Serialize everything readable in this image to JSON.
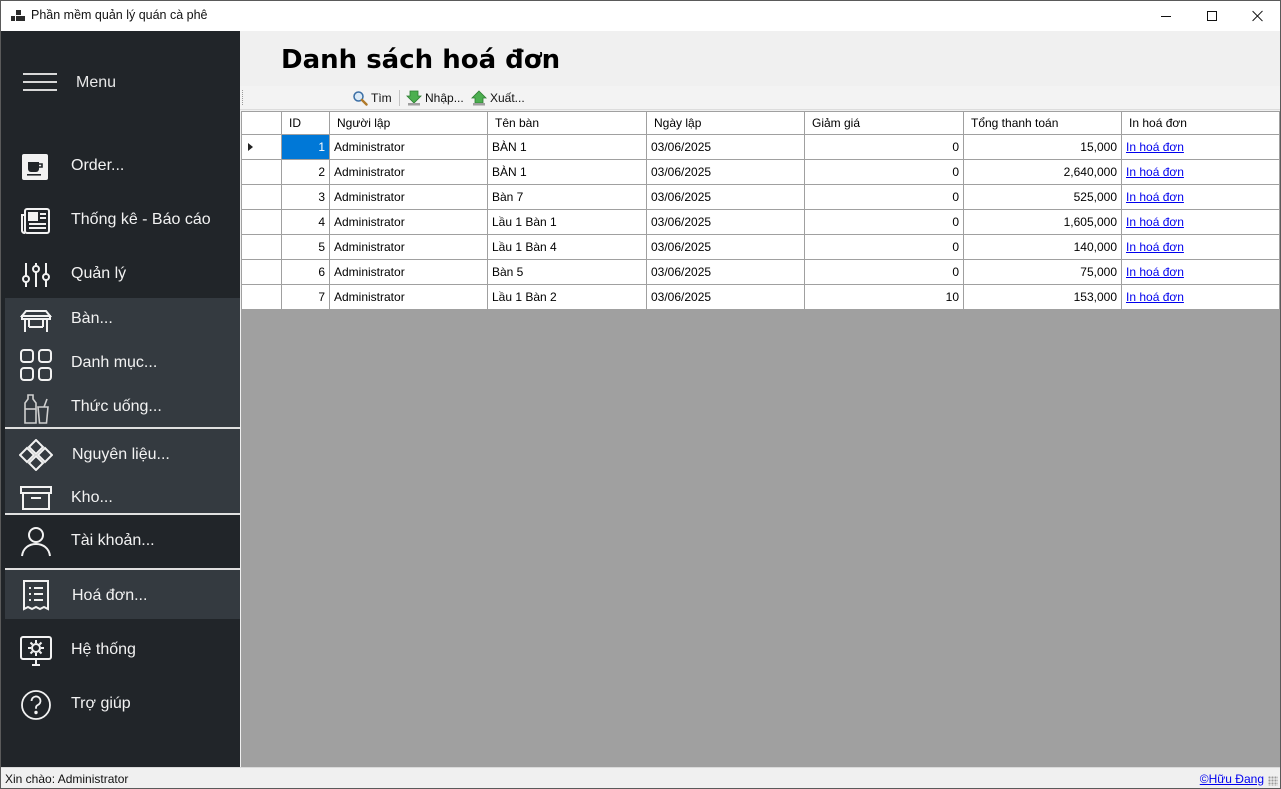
{
  "window": {
    "title": "Phần mềm quản lý quán cà phê"
  },
  "sidebar": {
    "menu_label": "Menu",
    "items": [
      {
        "label": "Order...",
        "icon": "coffee-icon"
      },
      {
        "label": "Thống kê - Báo cáo",
        "icon": "newspaper-icon"
      },
      {
        "label": "Quản lý",
        "icon": "sliders-icon"
      },
      {
        "label": "Bàn...",
        "icon": "table-icon"
      },
      {
        "label": "Danh mục...",
        "icon": "grid-icon"
      },
      {
        "label": "Thức uống...",
        "icon": "drinks-icon"
      },
      {
        "label": "Nguyên liệu...",
        "icon": "ingredients-icon"
      },
      {
        "label": "Kho...",
        "icon": "storage-box-icon"
      },
      {
        "label": "Tài khoản...",
        "icon": "user-icon"
      },
      {
        "label": "Hoá đơn...",
        "icon": "receipt-icon"
      },
      {
        "label": "Hệ thống",
        "icon": "monitor-settings-icon"
      },
      {
        "label": "Trợ giúp",
        "icon": "help-icon"
      }
    ]
  },
  "main": {
    "title": "Danh sách hoá đơn",
    "toolbar": {
      "search_label": "Tìm",
      "import_label": "Nhập...",
      "export_label": "Xuất..."
    },
    "table": {
      "columns": [
        "ID",
        "Người lập",
        "Tên bàn",
        "Ngày lập",
        "Giảm giá",
        "Tổng thanh toán",
        "In hoá đơn"
      ],
      "rows": [
        {
          "id": "1",
          "creator": "Administrator",
          "table": "BÀN 1",
          "date": "03/06/2025",
          "discount": "0",
          "total": "15,000",
          "print": "In hoá đơn"
        },
        {
          "id": "2",
          "creator": "Administrator",
          "table": "BÀN 1",
          "date": "03/06/2025",
          "discount": "0",
          "total": "2,640,000",
          "print": "In hoá đơn"
        },
        {
          "id": "3",
          "creator": "Administrator",
          "table": "Bàn 7",
          "date": "03/06/2025",
          "discount": "0",
          "total": "525,000",
          "print": "In hoá đơn"
        },
        {
          "id": "4",
          "creator": "Administrator",
          "table": "Lầu 1 Bàn 1",
          "date": "03/06/2025",
          "discount": "0",
          "total": "1,605,000",
          "print": "In hoá đơn"
        },
        {
          "id": "5",
          "creator": "Administrator",
          "table": "Lầu 1 Bàn 4",
          "date": "03/06/2025",
          "discount": "0",
          "total": "140,000",
          "print": "In hoá đơn"
        },
        {
          "id": "6",
          "creator": "Administrator",
          "table": "Bàn 5",
          "date": "03/06/2025",
          "discount": "0",
          "total": "75,000",
          "print": "In hoá đơn"
        },
        {
          "id": "7",
          "creator": "Administrator",
          "table": "Lầu 1 Bàn 2",
          "date": "03/06/2025",
          "discount": "10",
          "total": "153,000",
          "print": "In hoá đơn"
        }
      ]
    }
  },
  "status": {
    "greeting": "Xin chào: Administrator",
    "credit": "©Hữu Đang"
  },
  "colors": {
    "sidebar_bg": "#212529",
    "submenu_bg": "#343a40",
    "selection": "#0078d7",
    "grid_bg": "#a0a0a0"
  }
}
